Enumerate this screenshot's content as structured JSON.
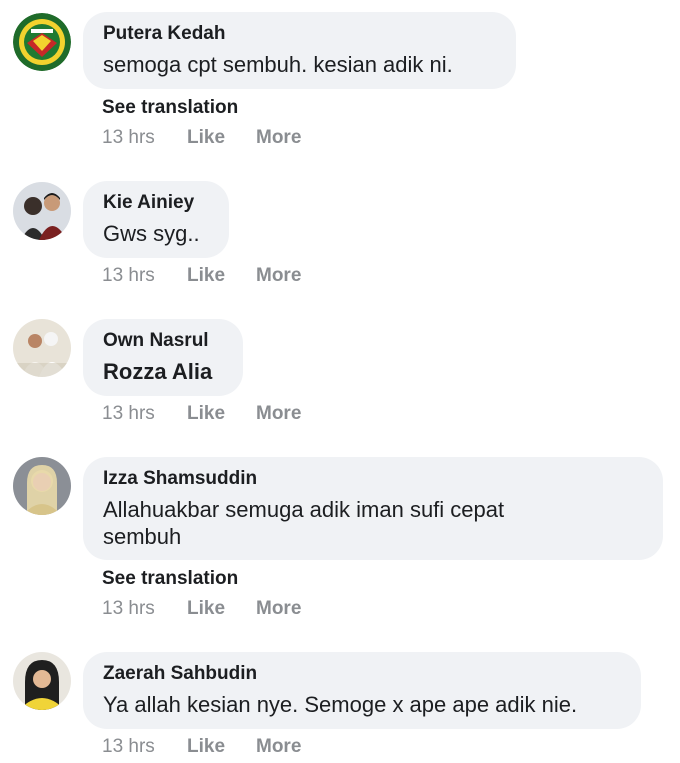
{
  "comments": [
    {
      "author": "Putera Kedah",
      "text": "semoga cpt sembuh. kesian adik ni.",
      "see_translation": "See translation",
      "time": "13 hrs",
      "like": "Like",
      "more": "More",
      "avatar_icon": "club-crest-avatar"
    },
    {
      "author": "Kie Ainiey",
      "text": "Gws syg..",
      "time": "13 hrs",
      "like": "Like",
      "more": "More",
      "avatar_icon": "couple-photo-avatar"
    },
    {
      "author": "Own Nasrul",
      "text": "Rozza Alia",
      "time": "13 hrs",
      "like": "Like",
      "more": "More",
      "avatar_icon": "wedding-photo-avatar"
    },
    {
      "author": "Izza Shamsuddin",
      "text": "Allahuakbar semuga adik iman sufi cepat sembuh",
      "see_translation": "See translation",
      "time": "13 hrs",
      "like": "Like",
      "more": "More",
      "avatar_icon": "woman-portrait-avatar"
    },
    {
      "author": "Zaerah Sahbudin",
      "text": "Ya allah kesian nye. Semoge x ape ape adik nie.",
      "time": "13 hrs",
      "like": "Like",
      "more": "More",
      "avatar_icon": "woman-yellow-avatar"
    }
  ],
  "colors": {
    "bubble": "#f0f2f5",
    "meta": "#8a8d91",
    "text": "#1c1e21"
  }
}
